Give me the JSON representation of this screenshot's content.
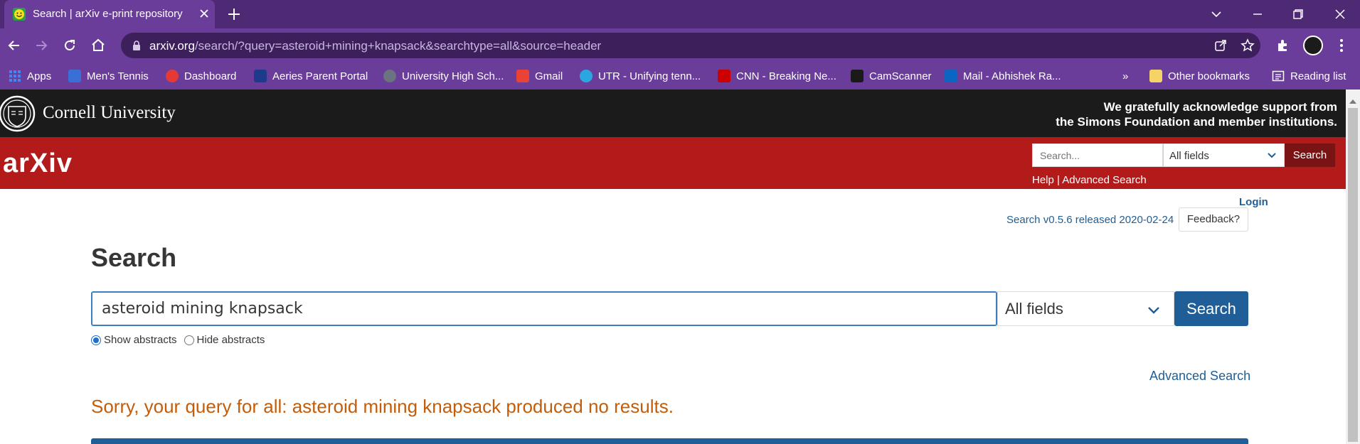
{
  "browser": {
    "tab": {
      "title": "Search | arXiv e-print repository"
    },
    "url": {
      "host": "arxiv.org",
      "path": "/search/?query=asteroid+mining+knapsack&searchtype=all&source=header"
    },
    "bookmarks": [
      {
        "label": "Apps",
        "color": "#4285f4"
      },
      {
        "label": "Men's Tennis",
        "color": "#3b6fd8"
      },
      {
        "label": "Dashboard",
        "color": "#e53935"
      },
      {
        "label": "Aeries Parent Portal",
        "color": "#1e3a8a"
      },
      {
        "label": "University High Sch...",
        "color": "#6b7280"
      },
      {
        "label": "Gmail",
        "color": "#ea4335"
      },
      {
        "label": "UTR - Unifying tenn...",
        "color": "#2aa7e0"
      },
      {
        "label": "CNN - Breaking Ne...",
        "color": "#cc0000"
      },
      {
        "label": "CamScanner",
        "color": "#1a1a1a"
      },
      {
        "label": "Mail - Abhishek Ra...",
        "color": "#0a66c2"
      }
    ],
    "other_bookmarks": "Other bookmarks",
    "reading_list": "Reading list",
    "chevron": "»"
  },
  "cornell": {
    "name": "Cornell University",
    "ack_line1": "We gratefully acknowledge support from",
    "ack_line2": "the Simons Foundation and member institutions."
  },
  "header": {
    "logo": "arXiv",
    "search_placeholder": "Search...",
    "field_select": "All fields",
    "search_button": "Search",
    "help_link": "Help",
    "separator": " | ",
    "advanced_link": "Advanced Search"
  },
  "main": {
    "login": "Login",
    "title": "Search",
    "version": "Search v0.5.6 released 2020-02-24",
    "feedback": "Feedback?",
    "query": "asteroid mining knapsack",
    "field_select": "All fields",
    "search_button": "Search",
    "show_abstracts": "Show abstracts",
    "hide_abstracts": "Hide abstracts",
    "advanced_search": "Advanced Search",
    "no_results": "Sorry, your query for all: asteroid mining knapsack produced no results."
  }
}
